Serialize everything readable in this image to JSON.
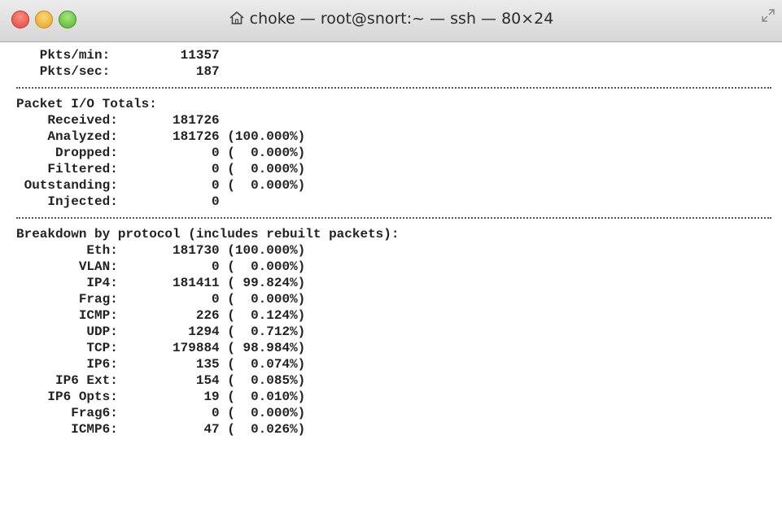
{
  "window": {
    "title": "choke — root@snort:~ — ssh — 80×24",
    "home_icon": "home-icon",
    "resize_icon": "resize-icon"
  },
  "terminal": {
    "pkts_min_label": "Pkts/min:",
    "pkts_min_value": "11357",
    "pkts_sec_label": "Pkts/sec:",
    "pkts_sec_value": "187",
    "io_header": "Packet I/O Totals:",
    "io_rows": [
      {
        "label": "Received:",
        "value": "181726",
        "pct": ""
      },
      {
        "label": "Analyzed:",
        "value": "181726",
        "pct": "(100.000%)"
      },
      {
        "label": "Dropped:",
        "value": "0",
        "pct": "(  0.000%)"
      },
      {
        "label": "Filtered:",
        "value": "0",
        "pct": "(  0.000%)"
      },
      {
        "label": "Outstanding:",
        "value": "0",
        "pct": "(  0.000%)"
      },
      {
        "label": "Injected:",
        "value": "0",
        "pct": ""
      }
    ],
    "proto_header": "Breakdown by protocol (includes rebuilt packets):",
    "proto_rows": [
      {
        "label": "Eth:",
        "value": "181730",
        "pct": "(100.000%)"
      },
      {
        "label": "VLAN:",
        "value": "0",
        "pct": "(  0.000%)"
      },
      {
        "label": "IP4:",
        "value": "181411",
        "pct": "( 99.824%)"
      },
      {
        "label": "Frag:",
        "value": "0",
        "pct": "(  0.000%)"
      },
      {
        "label": "ICMP:",
        "value": "226",
        "pct": "(  0.124%)"
      },
      {
        "label": "UDP:",
        "value": "1294",
        "pct": "(  0.712%)"
      },
      {
        "label": "TCP:",
        "value": "179884",
        "pct": "( 98.984%)"
      },
      {
        "label": "IP6:",
        "value": "135",
        "pct": "(  0.074%)"
      },
      {
        "label": "IP6 Ext:",
        "value": "154",
        "pct": "(  0.085%)"
      },
      {
        "label": "IP6 Opts:",
        "value": "19",
        "pct": "(  0.010%)"
      },
      {
        "label": "Frag6:",
        "value": "0",
        "pct": "(  0.000%)"
      },
      {
        "label": "ICMP6:",
        "value": "47",
        "pct": "(  0.026%)"
      }
    ]
  }
}
